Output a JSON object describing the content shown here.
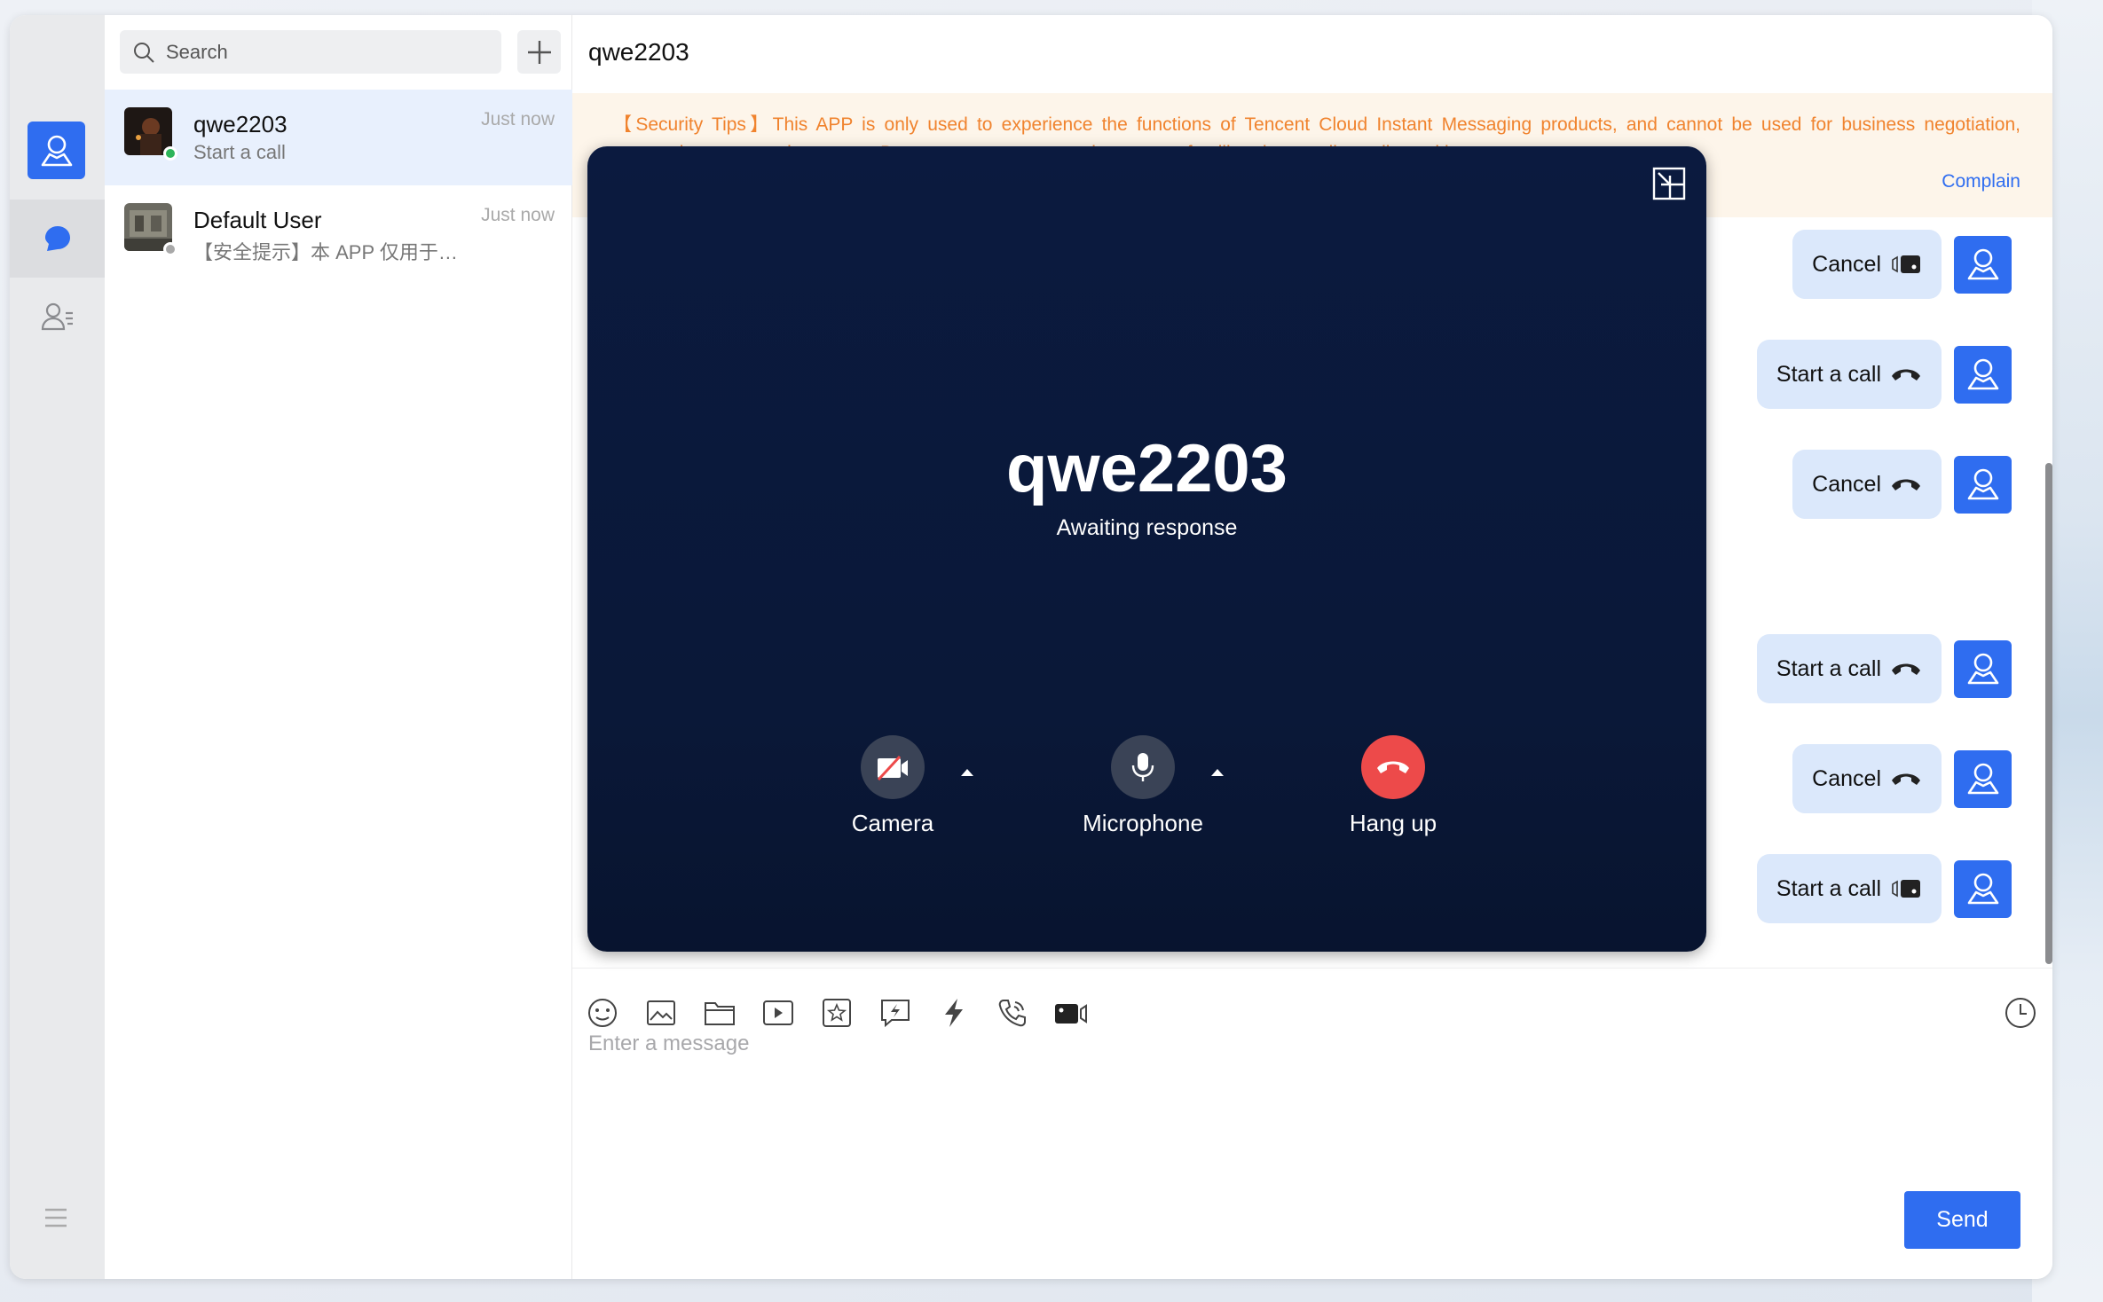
{
  "colors": {
    "accent": "#2f6df0",
    "danger": "#ed4a4a",
    "tips": "#f0832e",
    "bubble": "#dbe8fb",
    "callBg": "#0b1a3f"
  },
  "search": {
    "placeholder": "Search"
  },
  "conversations": [
    {
      "name": "qwe2203",
      "preview": "Start a call",
      "time": "Just now",
      "online": true
    },
    {
      "name": "Default User",
      "preview": "【安全提示】本 APP 仅用于…",
      "time": "Just now",
      "online": false
    }
  ],
  "chat": {
    "title": "qwe2203",
    "tips": "【Security Tips】This APP is only used to experience the functions of Tencent Cloud Instant Messaging products, and cannot be used for business negotiation, transaction, or any other usage. Do not trust strangers and answer unfamiliar phone calls easily, and beware",
    "tips_visible_left": "【Security Tips】This APP is only used to experience the functions of Tencent Cloud Instant Messaging products, and cannot be used for business",
    "tips_visible_right": "miliar phone calls easily, and beware",
    "complain": "Complain",
    "messages": [
      {
        "text": "Cancel",
        "icon": "video-call-icon"
      },
      {
        "text": "Start a call",
        "icon": "phone-call-icon"
      },
      {
        "text": "Cancel",
        "icon": "phone-call-icon"
      },
      {
        "text": "Start a call",
        "icon": "phone-call-icon"
      },
      {
        "text": "Cancel",
        "icon": "phone-call-icon"
      },
      {
        "text": "Start a call",
        "icon": "video-call-icon"
      }
    ],
    "input_placeholder": "Enter a message",
    "send": "Send",
    "tools": [
      "emoji-icon",
      "image-icon",
      "folder-icon",
      "video-icon",
      "star-icon",
      "quick-reply-icon",
      "flash-icon",
      "voice-call-icon",
      "video-call-icon"
    ]
  },
  "call": {
    "name": "qwe2203",
    "status": "Awaiting response",
    "camera": "Camera",
    "microphone": "Microphone",
    "hangup": "Hang up"
  }
}
